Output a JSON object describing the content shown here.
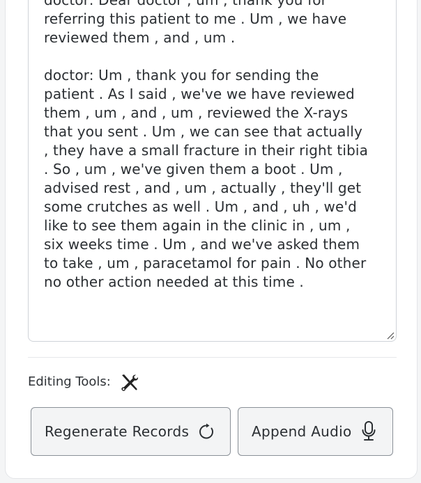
{
  "transcript": {
    "paragraphs": [
      "doctor: Dear doctor , um , thank you for\nreferring this patient to me . Um , we have\nreviewed them , and , um .",
      "doctor: Um , thank you for sending the\npatient . As I said , we've we have reviewed\nthem , um , and , um , reviewed the X-rays\nthat you sent . Um , we can see that actually\n, they have a small fracture in their right tibia\n. So , um , we've given them a boot . Um ,\nadvised rest , and , um , actually , they'll get\nsome crutches as well . Um , and , uh , we'd\nlike to see them again in the clinic in , um ,\nsix weeks time . Um , and we've asked them\nto take , um , paracetamol for pain . No other\nno other action needed at this time ."
    ]
  },
  "tools": {
    "label": "Editing Tools:",
    "icon": "tools-icon"
  },
  "buttons": {
    "regenerate_label": "Regenerate Records",
    "regenerate_icon": "refresh-icon",
    "append_label": "Append Audio",
    "append_icon": "microphone-icon"
  },
  "colors": {
    "text": "#2b2f33",
    "border": "#cfd3d8",
    "button_bg": "#f3f4f5",
    "button_border": "#8a9097"
  }
}
